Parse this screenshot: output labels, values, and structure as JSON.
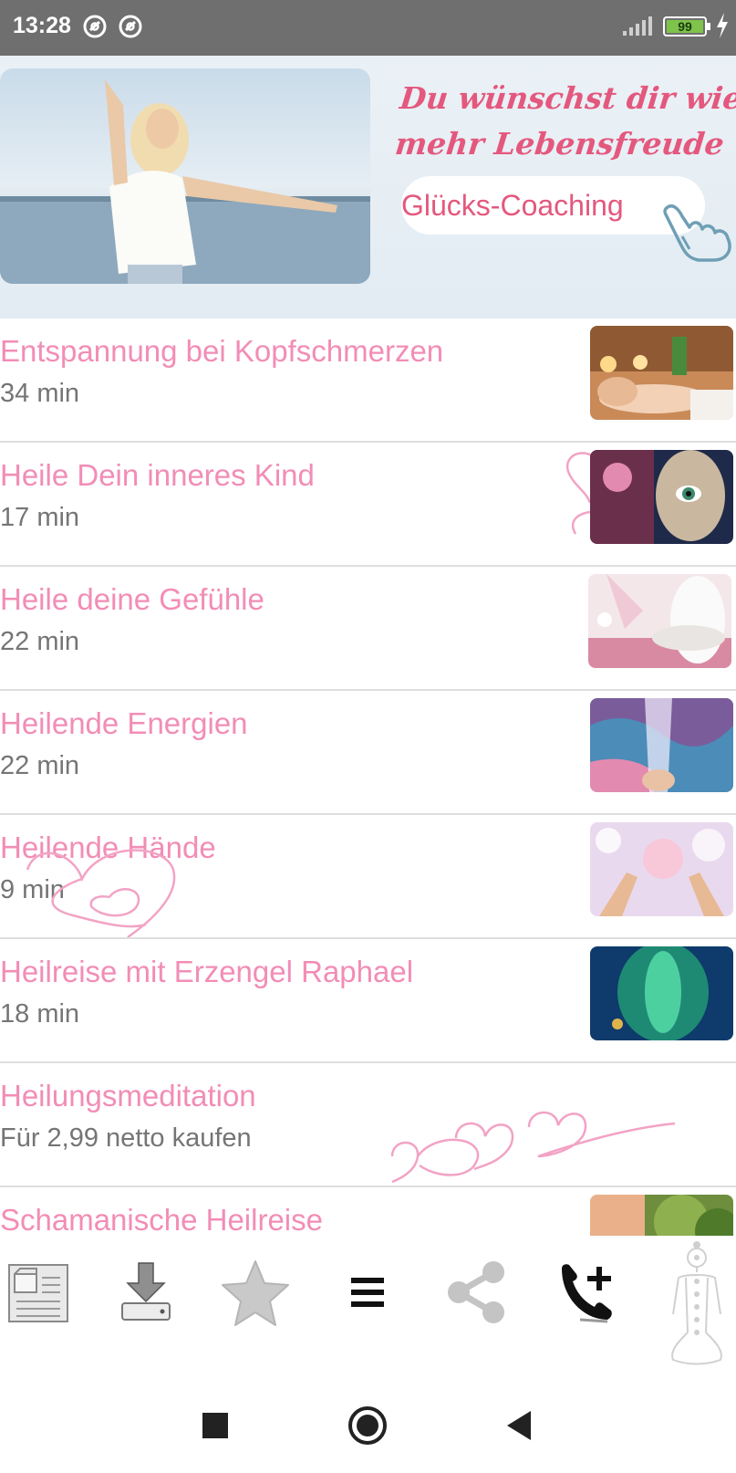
{
  "status_bar": {
    "time": "13:28",
    "battery": "99",
    "icons": [
      "at-sign-icon",
      "at-sign-icon",
      "signal-icon",
      "battery-icon",
      "charging-bolt-icon"
    ]
  },
  "banner": {
    "headline_line1": "Du wünschst dir wieder",
    "headline_line2": "mehr Lebensfreude ?",
    "cta_label": "Glücks-Coaching",
    "accent_color": "#e4587e"
  },
  "list": {
    "title_color": "#f28db6",
    "items": [
      {
        "title": "Entspannung bei Kopfschmerzen",
        "subtitle": "34 min"
      },
      {
        "title": "Heile Dein inneres Kind",
        "subtitle": "17 min"
      },
      {
        "title": "Heile deine Gefühle",
        "subtitle": "22 min"
      },
      {
        "title": "Heilende Energien",
        "subtitle": "22 min"
      },
      {
        "title": "Heilende Hände",
        "subtitle": "9 min"
      },
      {
        "title": "Heilreise mit Erzengel Raphael",
        "subtitle": "18 min"
      },
      {
        "title": "Heilungsmeditation",
        "subtitle": "Für 2,99 netto kaufen"
      },
      {
        "title": "Schamanische Heilreise",
        "subtitle": ""
      }
    ]
  },
  "toolbar": {
    "icons": [
      "document-icon",
      "download-icon",
      "star-icon",
      "menu-icon",
      "share-icon",
      "add-call-icon",
      "chakra-figure-icon"
    ]
  },
  "navbar": {
    "icons": [
      "recents-square-icon",
      "home-circle-icon",
      "back-triangle-icon"
    ]
  }
}
